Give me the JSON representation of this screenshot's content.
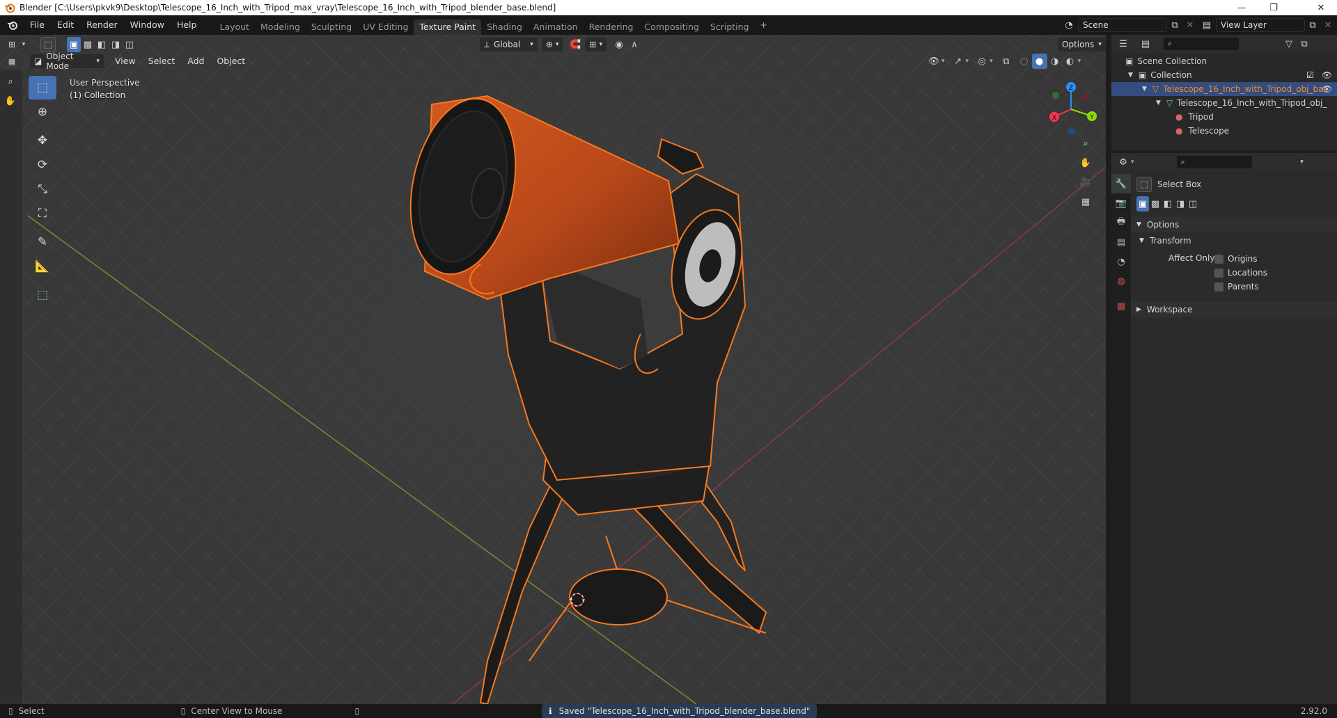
{
  "window": {
    "title": "Blender [C:\\Users\\pkvk9\\Desktop\\Telescope_16_Inch_with_Tripod_max_vray\\Telescope_16_Inch_with_Tripod_blender_base.blend]",
    "minimize": "—",
    "maximize": "❐",
    "close": "✕"
  },
  "menu": {
    "file": "File",
    "edit": "Edit",
    "render": "Render",
    "window": "Window",
    "help": "Help"
  },
  "workspaces": [
    "Layout",
    "Modeling",
    "Sculpting",
    "UV Editing",
    "Texture Paint",
    "Shading",
    "Animation",
    "Rendering",
    "Compositing",
    "Scripting"
  ],
  "workspace_active": "Texture Paint",
  "scene": {
    "name": "Scene",
    "view_layer": "View Layer"
  },
  "viewport_header": {
    "mode": "Object Mode",
    "view": "View",
    "select": "Select",
    "add": "Add",
    "object": "Object",
    "transform_orientation": "Global",
    "options": "Options"
  },
  "viewport_overlay": {
    "perspective": "User Perspective",
    "collection": "(1) Collection"
  },
  "gizmo": {
    "x": "X",
    "y": "Y",
    "z": "Z"
  },
  "outliner": {
    "scene_collection": "Scene Collection",
    "collection": "Collection",
    "object_selected": "Telescope_16_Inch_with_Tripod_obj_bas",
    "mesh": "Telescope_16_Inch_with_Tripod_obj_",
    "materials": [
      "Tripod",
      "Telescope"
    ]
  },
  "properties": {
    "tool_name": "Select Box",
    "options_label": "Options",
    "transform_label": "Transform",
    "affect_only": "Affect Only",
    "checkboxes": [
      "Origins",
      "Locations",
      "Parents"
    ],
    "workspace_label": "Workspace"
  },
  "statusbar": {
    "select": "Select",
    "center_view": "Center View to Mouse",
    "message": "Saved \"Telescope_16_Inch_with_Tripod_blender_base.blend\"",
    "version": "2.92.0"
  },
  "colors": {
    "accent": "#4772b3",
    "selection_outline": "#f7791e",
    "selected_text": "#f28a2e",
    "telescope_tube": "#c8501b",
    "axis_x": "#ff3352",
    "axis_y": "#8bdc00",
    "axis_z": "#2890ff"
  },
  "icons": [
    "blender-logo-icon",
    "editor-type-icon",
    "select-box-icon",
    "cursor-icon",
    "move-icon",
    "rotate-icon",
    "scale-icon",
    "transform-icon",
    "annotate-icon",
    "measure-icon",
    "add-cube-icon",
    "zoom-icon",
    "hand-pan-icon",
    "camera-icon",
    "ortho-grid-icon",
    "eye-icon",
    "search-icon",
    "filter-icon",
    "tool-icon",
    "render-icon",
    "output-icon",
    "view-layer-icon",
    "scene-icon",
    "world-icon",
    "texture-icon",
    "info-icon",
    "mouse-icon"
  ]
}
